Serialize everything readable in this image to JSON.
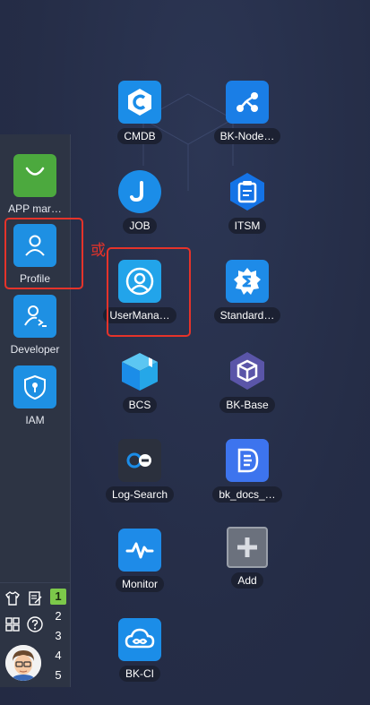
{
  "dock": {
    "apps": [
      {
        "label": "APP mar…",
        "icon": "shopping-bag-icon",
        "color": "#4ca93e"
      },
      {
        "label": "Profile",
        "icon": "user-icon",
        "color": "#1e90e3"
      },
      {
        "label": "Developer",
        "icon": "developer-user-icon",
        "color": "#1e90e3"
      },
      {
        "label": "IAM",
        "icon": "shield-lock-icon",
        "color": "#1e90e3"
      }
    ],
    "desktops": [
      "1",
      "2",
      "3",
      "4",
      "5"
    ],
    "active_desktop": "1",
    "tools": [
      "theme-shirt-icon",
      "notes-icon",
      "grid-icon",
      "help-icon"
    ]
  },
  "annotation": {
    "or_text": "或",
    "color": "#e5332a"
  },
  "apps": [
    {
      "label": "CMDB",
      "icon": "cmdb-c-icon",
      "color": "#1b8de8"
    },
    {
      "label": "BK-Node…",
      "icon": "node-graph-icon",
      "color": "#1a7ee6"
    },
    {
      "label": "JOB",
      "icon": "job-j-icon",
      "color": "#1b8de8"
    },
    {
      "label": "ITSM",
      "icon": "itsm-clipboard-icon",
      "color": "#1473e6"
    },
    {
      "label": "UserMana…",
      "icon": "user-management-icon",
      "color": "#22a4ea"
    },
    {
      "label": "Standard…",
      "icon": "standard-gear-icon",
      "color": "#1e8be8"
    },
    {
      "label": "BCS",
      "icon": "bcs-cube-icon",
      "color": "#25a7e8"
    },
    {
      "label": "BK-Base",
      "icon": "bk-base-icon",
      "color": "#5a55a8"
    },
    {
      "label": "Log-Search",
      "icon": "log-search-icon",
      "color": "#2b303d"
    },
    {
      "label": "bk_docs_…",
      "icon": "docs-icon",
      "color": "#3d74ee"
    },
    {
      "label": "Monitor",
      "icon": "monitor-wave-icon",
      "color": "#1e8be8"
    },
    {
      "label": "Add",
      "icon": "plus-icon",
      "color": "#6b717d"
    },
    {
      "label": "BK-CI",
      "icon": "bk-ci-cloud-icon",
      "color": "#1b8de8"
    }
  ]
}
